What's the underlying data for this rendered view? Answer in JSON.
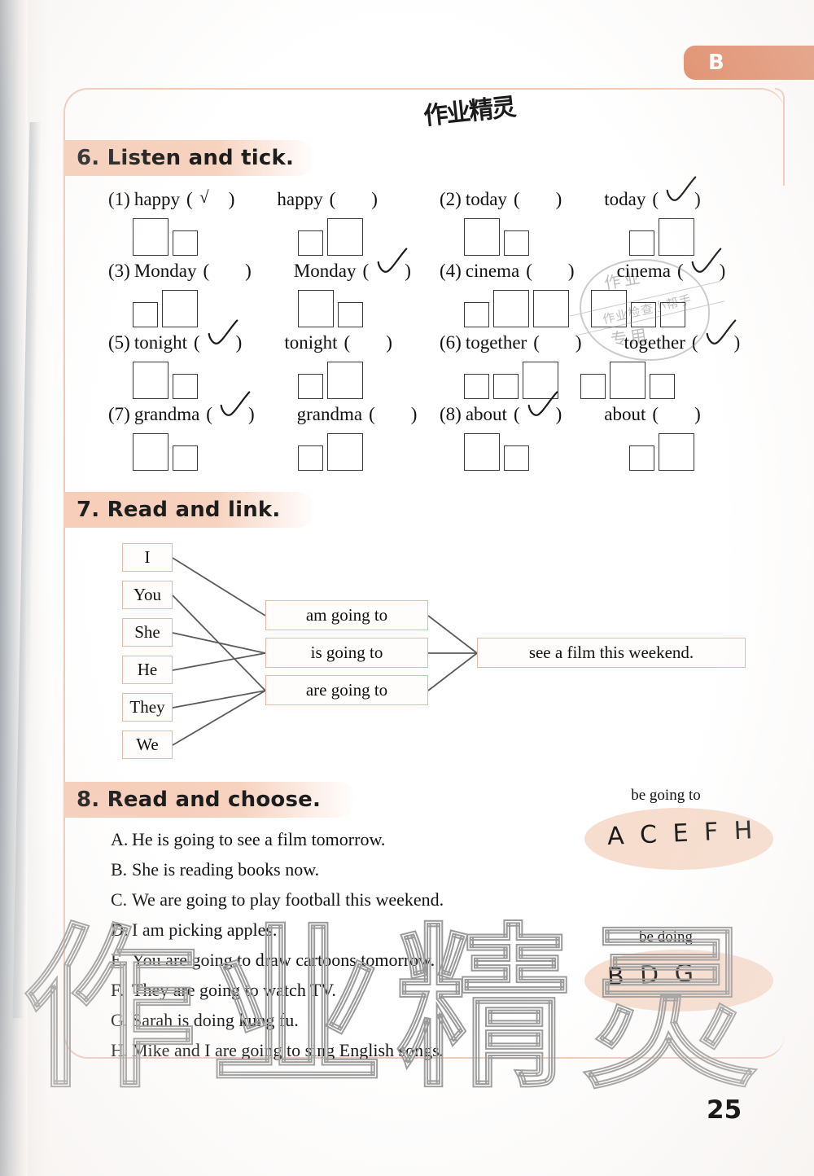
{
  "page": {
    "number": "25",
    "unit_tab": "B",
    "accent_color": "#e08864",
    "header_bg": "#f6cdb8",
    "frame_color": "#f2c7b4"
  },
  "watermarks": {
    "handwritten_top": "作业精灵",
    "large_outline": "作业精灵",
    "stamp_top": "作业",
    "stamp_band": "作业检查小帮手",
    "stamp_bottom": "专用"
  },
  "section6": {
    "title": "6. Listen and tick.",
    "items": [
      {
        "num": "(1)",
        "word": "happy",
        "left_tick": "check-plain",
        "right_tick": "none",
        "left_boxes": [
          "big",
          "small"
        ],
        "right_boxes": [
          "small",
          "big"
        ]
      },
      {
        "num": "(2)",
        "word": "today",
        "left_tick": "none",
        "right_tick": "check-hand",
        "left_boxes": [
          "big",
          "small"
        ],
        "right_boxes": [
          "small",
          "big"
        ]
      },
      {
        "num": "(3)",
        "word": "Monday",
        "left_tick": "none",
        "right_tick": "check-hand",
        "left_boxes": [
          "small",
          "big"
        ],
        "right_boxes": [
          "big",
          "small"
        ]
      },
      {
        "num": "(4)",
        "word": "cinema",
        "left_tick": "none",
        "right_tick": "check-hand",
        "left_boxes": [
          "small",
          "big",
          "big"
        ],
        "right_boxes": [
          "big",
          "small",
          "small"
        ]
      },
      {
        "num": "(5)",
        "word": "tonight",
        "left_tick": "check-hand",
        "right_tick": "none",
        "left_boxes": [
          "big",
          "small"
        ],
        "right_boxes": [
          "small",
          "big"
        ]
      },
      {
        "num": "(6)",
        "word": "together",
        "left_tick": "none",
        "right_tick": "check-hand",
        "left_boxes": [
          "small",
          "small",
          "big"
        ],
        "right_boxes": [
          "small",
          "big",
          "small"
        ]
      },
      {
        "num": "(7)",
        "word": "grandma",
        "left_tick": "check-hand",
        "right_tick": "none",
        "left_boxes": [
          "big",
          "small"
        ],
        "right_boxes": [
          "small",
          "big"
        ]
      },
      {
        "num": "(8)",
        "word": "about",
        "left_tick": "check-hand",
        "right_tick": "none",
        "left_boxes": [
          "big",
          "small"
        ],
        "right_boxes": [
          "small",
          "big"
        ]
      }
    ]
  },
  "section7": {
    "title": "7. Read and link.",
    "subjects": [
      "I",
      "You",
      "She",
      "He",
      "They",
      "We"
    ],
    "verbs": [
      "am going to",
      "is going to",
      "are going to"
    ],
    "predicate": "see a film this weekend.",
    "links": [
      {
        "from": "I",
        "to": "am going to"
      },
      {
        "from": "You",
        "to": "are going to"
      },
      {
        "from": "She",
        "to": "is going to"
      },
      {
        "from": "He",
        "to": "is going to"
      },
      {
        "from": "They",
        "to": "are going to"
      },
      {
        "from": "We",
        "to": "are going to"
      }
    ],
    "verb_links": [
      "am going to",
      "is going to",
      "are going to"
    ]
  },
  "section8": {
    "title": "8. Read and choose.",
    "choices": [
      {
        "label": "A.",
        "text": "He is going to see a film tomorrow."
      },
      {
        "label": "B.",
        "text": "She is reading books now."
      },
      {
        "label": "C.",
        "text": "We are going to play football this weekend."
      },
      {
        "label": "D.",
        "text": "I am picking apples."
      },
      {
        "label": "E.",
        "text": "You are going to draw cartoons tomorrow."
      },
      {
        "label": "F.",
        "text": "They are going to watch TV."
      },
      {
        "label": "G.",
        "text": "Sarah is doing kung fu."
      },
      {
        "label": "H.",
        "text": "Mike and I are going to sing English songs."
      }
    ],
    "answer_groups": [
      {
        "label": "be going to",
        "answer": "A C E F H"
      },
      {
        "label": "be doing",
        "answer": "B D G"
      }
    ]
  }
}
